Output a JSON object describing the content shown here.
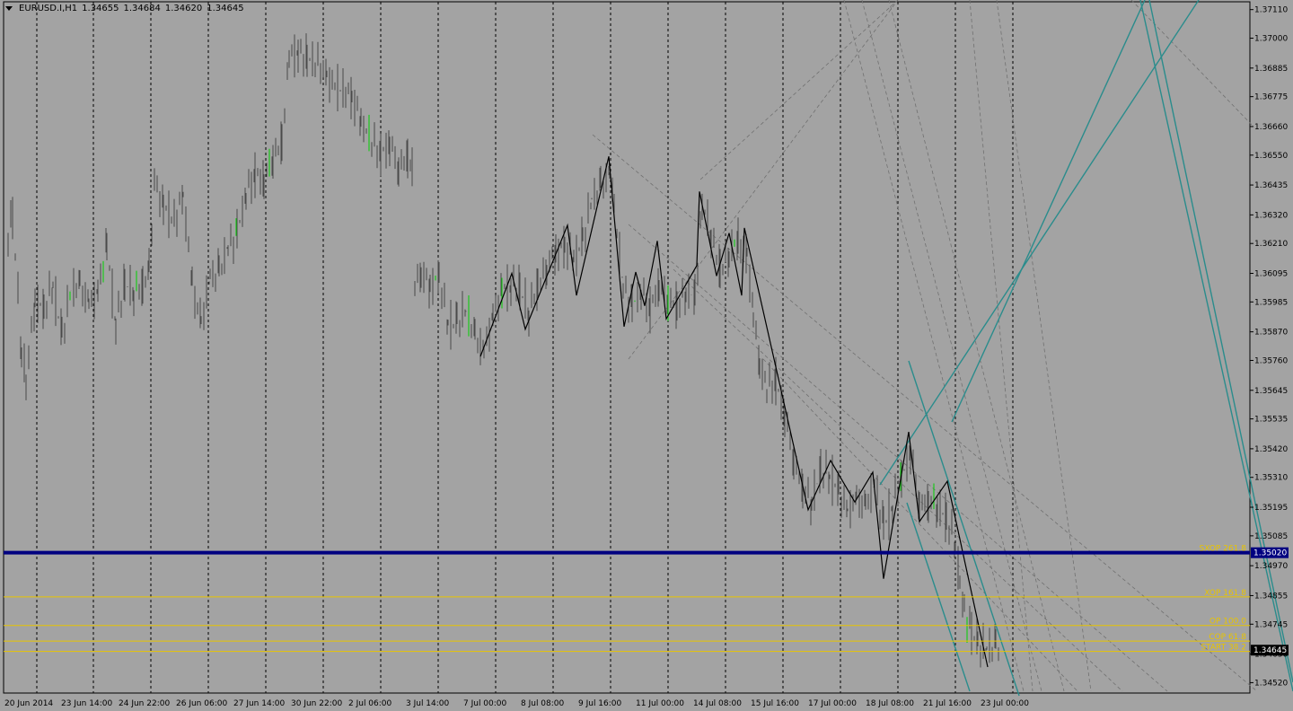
{
  "header": {
    "symbol": "EURUSD.I,H1",
    "open": "1.34655",
    "high": "1.34684",
    "low": "1.34620",
    "close": "1.34645"
  },
  "colors": {
    "background": "#a3a3a3",
    "bar": "#4a4a4a",
    "bull_bar": "#00d000",
    "zigzag": "#000000",
    "support": "#000080",
    "level": "#e8c400",
    "channel": "#2a8c8c",
    "guide": "#707070"
  },
  "chart_data": {
    "type": "ohlc",
    "symbol": "EURUSD.I",
    "timeframe": "H1",
    "grid": true,
    "ylim": [
      1.3448,
      1.3714
    ],
    "xlim": [
      0,
      1110
    ],
    "y_ticks": [
      "1.37110",
      "1.37000",
      "1.36885",
      "1.36775",
      "1.36660",
      "1.36550",
      "1.36435",
      "1.36320",
      "1.36210",
      "1.36095",
      "1.35985",
      "1.35870",
      "1.35760",
      "1.35645",
      "1.35535",
      "1.35420",
      "1.35310",
      "1.35195",
      "1.35085",
      "1.34970",
      "1.34855",
      "1.34745",
      "1.34630",
      "1.34520"
    ],
    "x_ticks": [
      {
        "label": "20 Jun 2014",
        "x": 5
      },
      {
        "label": "23 Jun 14:00",
        "x": 68
      },
      {
        "label": "24 Jun 22:00",
        "x": 132
      },
      {
        "label": "26 Jun 06:00",
        "x": 196
      },
      {
        "label": "27 Jun 14:00",
        "x": 260
      },
      {
        "label": "30 Jun 22:00",
        "x": 324
      },
      {
        "label": "2 Jul 06:00",
        "x": 388
      },
      {
        "label": "3 Jul 14:00",
        "x": 452
      },
      {
        "label": "7 Jul 00:00",
        "x": 516
      },
      {
        "label": "8 Jul 08:00",
        "x": 580
      },
      {
        "label": "9 Jul 16:00",
        "x": 644
      },
      {
        "label": "11 Jul 00:00",
        "x": 708
      },
      {
        "label": "14 Jul 08:00",
        "x": 772
      },
      {
        "label": "15 Jul 16:00",
        "x": 836
      },
      {
        "label": "17 Jul 00:00",
        "x": 900
      },
      {
        "label": "18 Jul 08:00",
        "x": 964
      },
      {
        "label": "21 Jul 16:00",
        "x": 1028
      },
      {
        "label": "23 Jul 00:00",
        "x": 1092
      }
    ],
    "price_path": [
      [
        5,
        1.3625
      ],
      [
        10,
        1.3632
      ],
      [
        20,
        1.358
      ],
      [
        25,
        1.3568
      ],
      [
        35,
        1.36
      ],
      [
        45,
        1.3595
      ],
      [
        55,
        1.3605
      ],
      [
        65,
        1.3585
      ],
      [
        75,
        1.3603
      ],
      [
        85,
        1.3605
      ],
      [
        95,
        1.3598
      ],
      [
        105,
        1.3602
      ],
      [
        115,
        1.362
      ],
      [
        125,
        1.359
      ],
      [
        135,
        1.3605
      ],
      [
        145,
        1.3603
      ],
      [
        155,
        1.3605
      ],
      [
        162,
        1.361
      ],
      [
        168,
        1.3645
      ],
      [
        178,
        1.3635
      ],
      [
        190,
        1.363
      ],
      [
        200,
        1.364
      ],
      [
        210,
        1.3605
      ],
      [
        220,
        1.359
      ],
      [
        230,
        1.3608
      ],
      [
        240,
        1.361
      ],
      [
        250,
        1.362
      ],
      [
        260,
        1.3625
      ],
      [
        270,
        1.364
      ],
      [
        280,
        1.3648
      ],
      [
        290,
        1.3645
      ],
      [
        300,
        1.3655
      ],
      [
        310,
        1.366
      ],
      [
        318,
        1.3693
      ],
      [
        328,
        1.3695
      ],
      [
        338,
        1.3692
      ],
      [
        350,
        1.369
      ],
      [
        360,
        1.3685
      ],
      [
        375,
        1.368
      ],
      [
        388,
        1.3678
      ],
      [
        398,
        1.3668
      ],
      [
        410,
        1.366
      ],
      [
        420,
        1.3655
      ],
      [
        430,
        1.366
      ],
      [
        440,
        1.365
      ],
      [
        450,
        1.3655
      ],
      [
        455,
        1.365
      ],
      [
        458,
        1.3605
      ],
      [
        465,
        1.361
      ],
      [
        475,
        1.3605
      ],
      [
        485,
        1.3608
      ],
      [
        495,
        1.359
      ],
      [
        505,
        1.359
      ],
      [
        515,
        1.3595
      ],
      [
        525,
        1.3585
      ],
      [
        535,
        1.358
      ],
      [
        545,
        1.3593
      ],
      [
        555,
        1.3603
      ],
      [
        565,
        1.3605
      ],
      [
        575,
        1.3603
      ],
      [
        585,
        1.3595
      ],
      [
        595,
        1.3605
      ],
      [
        605,
        1.3612
      ],
      [
        615,
        1.3618
      ],
      [
        625,
        1.362
      ],
      [
        635,
        1.3615
      ],
      [
        645,
        1.3622
      ],
      [
        655,
        1.3638
      ],
      [
        665,
        1.3643
      ],
      [
        675,
        1.3648
      ],
      [
        680,
        1.3635
      ],
      [
        690,
        1.3605
      ],
      [
        700,
        1.3597
      ],
      [
        710,
        1.3603
      ],
      [
        720,
        1.3596
      ],
      [
        730,
        1.3605
      ],
      [
        740,
        1.36
      ],
      [
        750,
        1.3597
      ],
      [
        760,
        1.3603
      ],
      [
        770,
        1.36
      ],
      [
        778,
        1.3636
      ],
      [
        788,
        1.3625
      ],
      [
        798,
        1.3611
      ],
      [
        808,
        1.3618
      ],
      [
        818,
        1.3622
      ],
      [
        828,
        1.3618
      ],
      [
        835,
        1.3593
      ],
      [
        842,
        1.3575
      ],
      [
        850,
        1.3565
      ],
      [
        860,
        1.3568
      ],
      [
        870,
        1.3555
      ],
      [
        880,
        1.3538
      ],
      [
        890,
        1.3527
      ],
      [
        900,
        1.3522
      ],
      [
        910,
        1.3533
      ],
      [
        920,
        1.3532
      ],
      [
        930,
        1.3525
      ],
      [
        940,
        1.3518
      ],
      [
        950,
        1.3523
      ],
      [
        960,
        1.352
      ],
      [
        970,
        1.3528
      ],
      [
        980,
        1.3512
      ],
      [
        990,
        1.352
      ],
      [
        1000,
        1.353
      ],
      [
        1010,
        1.3542
      ],
      [
        1020,
        1.352
      ],
      [
        1030,
        1.3522
      ],
      [
        1040,
        1.352
      ],
      [
        1050,
        1.3515
      ],
      [
        1060,
        1.3505
      ],
      [
        1065,
        1.349
      ],
      [
        1070,
        1.348
      ],
      [
        1078,
        1.3472
      ],
      [
        1085,
        1.3466
      ],
      [
        1095,
        1.3465
      ],
      [
        1105,
        1.3466
      ],
      [
        1110,
        1.3465
      ]
    ],
    "zigzag": [
      [
        535,
        1.35775
      ],
      [
        570,
        1.36095
      ],
      [
        585,
        1.3588
      ],
      [
        632,
        1.3628
      ],
      [
        642,
        1.3601
      ],
      [
        678,
        1.36545
      ],
      [
        695,
        1.3589
      ],
      [
        708,
        1.361
      ],
      [
        718,
        1.3597
      ],
      [
        732,
        1.3622
      ],
      [
        742,
        1.3592
      ],
      [
        776,
        1.36125
      ],
      [
        779,
        1.3641
      ],
      [
        798,
        1.36085
      ],
      [
        812,
        1.3625
      ],
      [
        826,
        1.3601
      ],
      [
        829,
        1.3627
      ],
      [
        900,
        1.35185
      ],
      [
        925,
        1.35375
      ],
      [
        952,
        1.35215
      ],
      [
        972,
        1.3533
      ],
      [
        984,
        1.3492
      ],
      [
        1012,
        1.35485
      ],
      [
        1024,
        1.3514
      ],
      [
        1055,
        1.35295
      ],
      [
        1100,
        1.3458
      ]
    ],
    "support": 1.3502,
    "support_label": "1.35020",
    "last_price_label": "1.34645",
    "levels": [
      {
        "label": "SXOP 261.8",
        "value": 1.3502
      },
      {
        "label": "XOP 161.8",
        "value": 1.3485
      },
      {
        "label": "OP 100.0",
        "value": 1.3474
      },
      {
        "label": "COP 61.8",
        "value": 1.3468
      },
      {
        "label": "START 38.2",
        "value": 1.3464
      }
    ]
  }
}
